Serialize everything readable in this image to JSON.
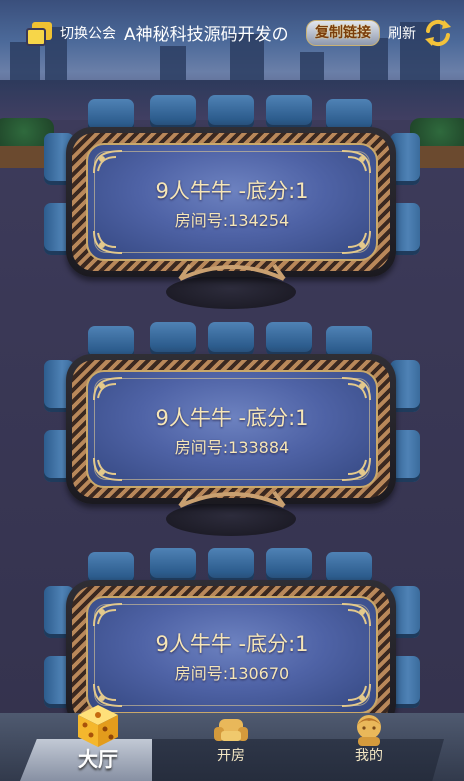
{
  "header": {
    "switch_label": "切换公会",
    "title": "A神秘科技源码开发の",
    "copy_button": "复制链接",
    "refresh_label": "刷新"
  },
  "rooms": [
    {
      "title": "9人牛牛 -底分:1",
      "room_number": "房间号:134254"
    },
    {
      "title": "9人牛牛 -底分:1",
      "room_number": "房间号:133884"
    },
    {
      "title": "9人牛牛 -底分:1",
      "room_number": "房间号:130670"
    }
  ],
  "nav": {
    "lobby": "大厅",
    "create_room": "开房",
    "mine": "我的",
    "active": "lobby"
  },
  "colors": {
    "accent_gold": "#f7d649",
    "felt_blue": "#4f63a6",
    "chair_blue": "#3a6b9c",
    "text_cream": "#f6e6b7"
  },
  "icons": {
    "switch": "switch-guild-icon",
    "refresh": "refresh-icon",
    "lobby": "dice-icon",
    "create_room": "sofa-icon",
    "mine": "avatar-icon"
  }
}
